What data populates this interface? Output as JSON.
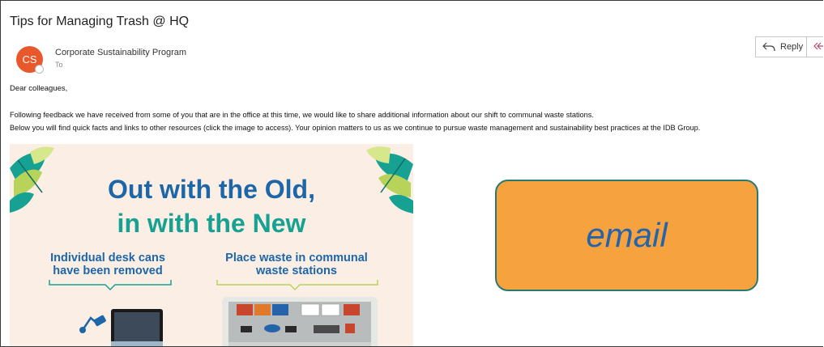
{
  "email": {
    "subject": "Tips for Managing Trash @ HQ",
    "sender": {
      "initials": "CS",
      "name": "Corporate Sustainability Program",
      "to_label": "To",
      "avatar_color": "#e8582b"
    },
    "actions": {
      "reply_label": "Reply",
      "reply_icon": "reply-arrow-icon",
      "reply_all_icon": "reply-all-arrow-icon"
    },
    "body": {
      "greeting": "Dear colleagues,",
      "paragraph_1": "Following feedback we have received from some of you that are in the office at this time, we would like to share additional information about our shift to communal waste stations.",
      "paragraph_2": "Below you will find quick facts and links to other resources (click the image to access). Your opinion matters to us as we continue to pursue waste management and sustainability best practices at the IDB Group."
    },
    "poster": {
      "headline_line1": "Out with the Old,",
      "headline_line2": "in with the New",
      "left_caption_line1": "Individual desk cans",
      "left_caption_line2": "have been removed",
      "right_caption_line1": "Place waste in communal",
      "right_caption_line2": "waste stations",
      "colors": {
        "background": "#fbeee5",
        "headline_blue": "#1d66a8",
        "headline_teal": "#17a192",
        "bracket_green": "#b8d35a"
      }
    }
  },
  "overlay": {
    "label": "email",
    "fill": "#f6a33f",
    "border": "#287a70",
    "text_color": "#2563aa"
  }
}
